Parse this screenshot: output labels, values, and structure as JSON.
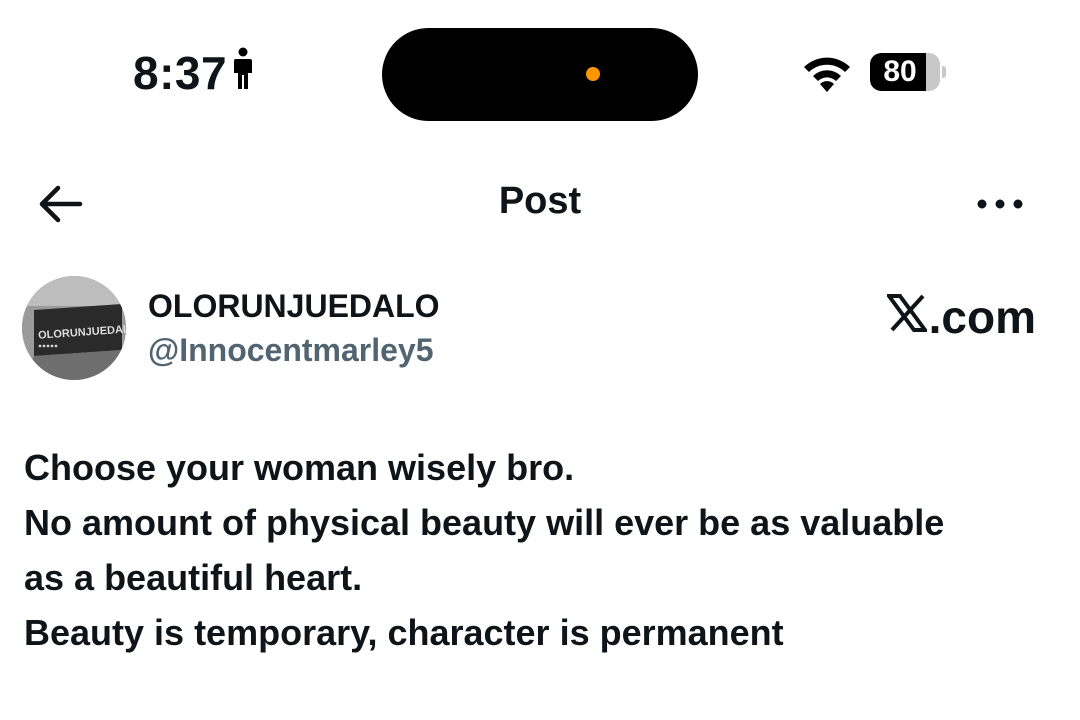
{
  "status_bar": {
    "time": "8:37",
    "battery_level": "80",
    "battery_fraction": 0.8,
    "accent_dot_color": "#ff9500"
  },
  "nav": {
    "title": "Post",
    "back_icon": "arrow-left-icon",
    "more_icon": "ellipsis-icon"
  },
  "post": {
    "author_name": "OLORUNJUEDALO",
    "author_handle": "@Innocentmarley5",
    "avatar_text": "OLORUNJUEDALO",
    "watermark": ".com",
    "lines": [
      "Choose your woman wisely bro.",
      "No amount of physical beauty will ever be as valuable",
      "as a beautiful heart.",
      "Beauty is temporary, character is permanent"
    ]
  },
  "colors": {
    "text_primary": "#0f1419",
    "text_secondary": "#536471"
  }
}
